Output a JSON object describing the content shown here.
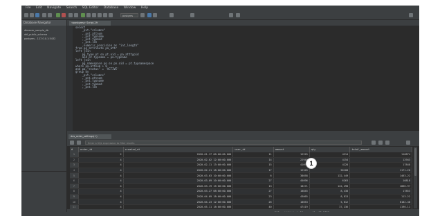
{
  "menubar": [
    "File",
    "Edit",
    "Navigate",
    "Search",
    "SQL Editor",
    "Database",
    "Window",
    "Help"
  ],
  "toolbar": {
    "combo_value": "postgres"
  },
  "left_panel": {
    "tab_label": "Database Navigator",
    "tree": [
      "dbeaver_sample_db",
      "ddl_public_schema",
      "postgres - 127.0.0.1:5432"
    ]
  },
  "editor": {
    "tab_label": "<postgres> Script-29",
    "code": [
      "select",
      "    _pvt.\"columns\"",
      "    ,_pvt.attnum",
      "    ,_pvt.typname",
      "    ,_pvt.typmod",
      "    ,_pvt.len",
      "    ,numeric_precision as \"int_length\"",
      "from pg_attribute pa_attr",
      "left join",
      "    pg_type pt on pt.oid = pa.atttypid",
      "    and pt.typname = pa.typname",
      "left join",
      "    pg_namespace pn on pn.oid = pt.typnamespace",
      "where pa.attnum > 0",
      "and pa.\"status\" = 'ACTIVE'",
      "group by",
      "    _pvt.\"columns\"",
      "    ,_pvt.attnum",
      "    ,_pvt.typname",
      "    ,_pvt.typmod",
      "    ,_pvt.len"
    ]
  },
  "results": {
    "tab_label": "des_order_settings(+)",
    "filter_placeholder": "Enter a SQL expression to filter results",
    "columns": [
      "#",
      "order_id",
      "created_at",
      "user_id",
      "amount",
      "qty",
      "total_amount"
    ],
    "rows": [
      [
        "1",
        "2",
        "2020-01-17 00:00:00.000",
        "11",
        "12225",
        "4214",
        "116874"
      ],
      [
        "2",
        "4",
        "2020-02-02 12:00:00.000",
        "14",
        "22940",
        "4154",
        "12943"
      ],
      [
        "3",
        "4",
        "2020-02-11 13:00:00.000",
        "15",
        "41094",
        "4228",
        "17848"
      ],
      [
        "4",
        "4",
        "2020-02-21 18:00:00.000",
        "17",
        "12345",
        "50108",
        "1171.20"
      ],
      [
        "5",
        "4",
        "2020-03-03 10:00:00.000",
        "6",
        "38058",
        "132,449",
        "1463.22"
      ],
      [
        "6",
        "4",
        "2020-03-09 10:00:00.000",
        "27",
        "45096",
        "6263",
        "16818"
      ],
      [
        "7",
        "4",
        "2020-03-19 15:00:00.000",
        "13",
        "18271",
        "122,498",
        "1066.97"
      ],
      [
        "8",
        "4",
        "2020-03-27 08:00:00.000",
        "27",
        "10845",
        "8,438",
        "17853"
      ],
      [
        "9",
        "4",
        "2020-04-09 18:00:00.000",
        "23",
        "43065",
        "8,813",
        "113.22"
      ],
      [
        "10",
        "4",
        "2020-04-23 12:00:00.000",
        "26",
        "10053",
        "5,012",
        "6182.48"
      ],
      [
        "11",
        "4",
        "2020-05-11 18:00:00.000",
        "40",
        "47419",
        "37,236",
        "1196.11"
      ]
    ],
    "status": "200 row(s) fetched - 12 ms, on May 12, 2020"
  },
  "badge": {
    "label": "1"
  }
}
